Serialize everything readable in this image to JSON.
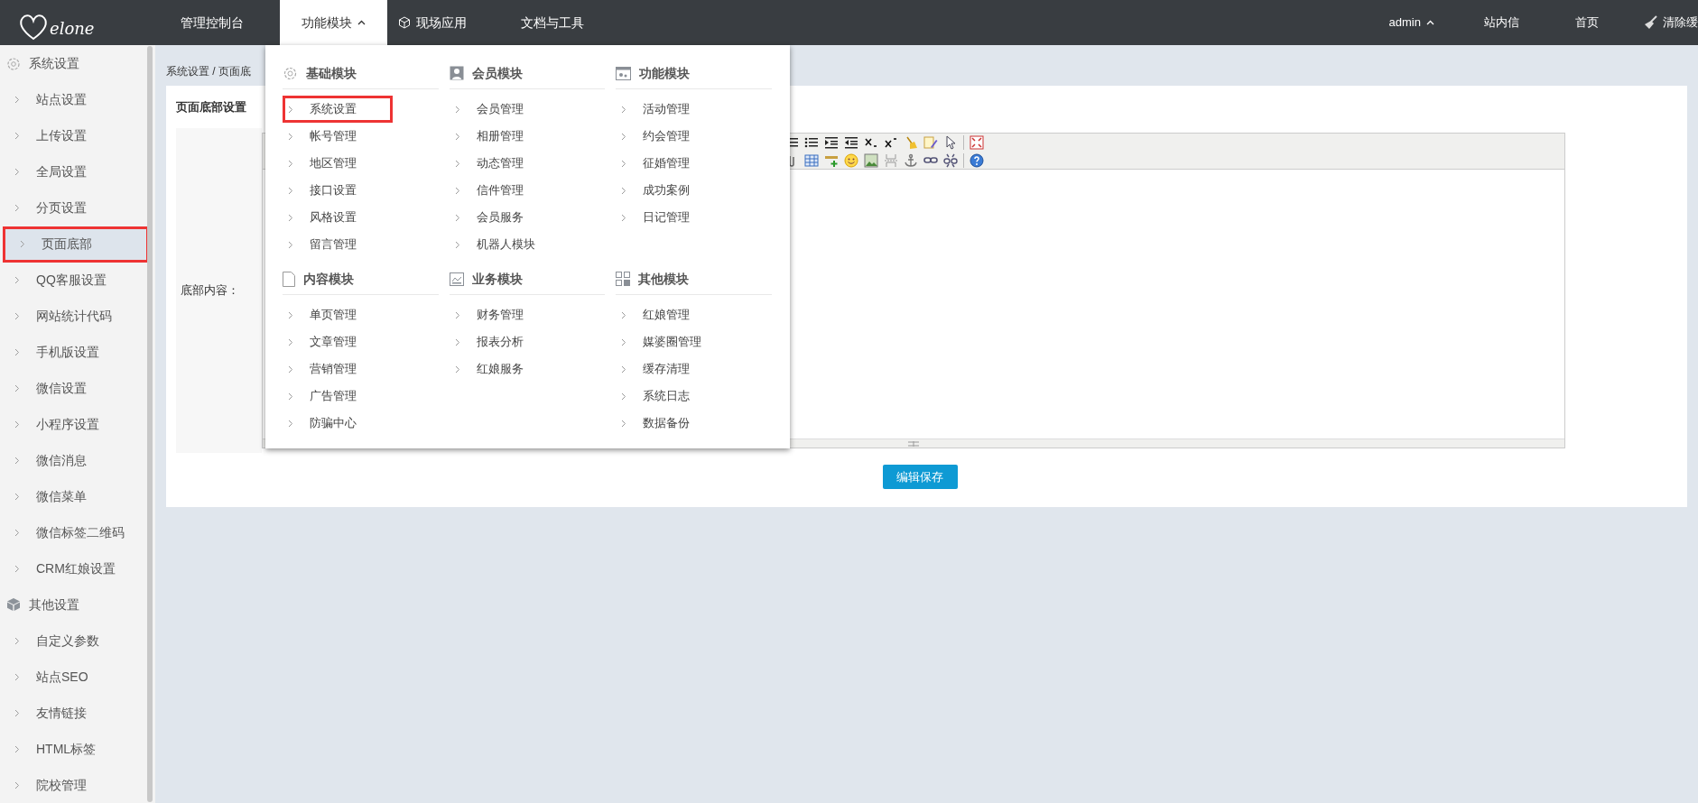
{
  "header": {
    "logo": "elone",
    "nav": [
      {
        "label": "管理控制台",
        "selected": false
      },
      {
        "label": "功能模块",
        "selected": true,
        "expanded": true
      },
      {
        "label": "现场应用",
        "selected": false
      },
      {
        "label": "文档与工具",
        "selected": false
      }
    ],
    "user": {
      "label": "admin",
      "expanded": true
    },
    "right_links": [
      "站内信",
      "首页",
      "清除缓"
    ]
  },
  "sidebar": [
    {
      "title": "系统设置",
      "children": [
        {
          "label": "站点设置",
          "selected": false
        },
        {
          "label": "上传设置",
          "selected": false
        },
        {
          "label": "全局设置",
          "selected": false
        },
        {
          "label": "分页设置",
          "selected": false
        },
        {
          "label": "页面底部",
          "selected": true
        },
        {
          "label": "QQ客服设置",
          "selected": false
        },
        {
          "label": "网站统计代码",
          "selected": false
        },
        {
          "label": "手机版设置",
          "selected": false
        },
        {
          "label": "微信设置",
          "selected": false
        },
        {
          "label": "小程序设置",
          "selected": false
        },
        {
          "label": "微信消息",
          "selected": false
        },
        {
          "label": "微信菜单",
          "selected": false
        },
        {
          "label": "微信标签二维码",
          "selected": false
        },
        {
          "label": "CRM红娘设置",
          "selected": false
        }
      ]
    },
    {
      "title": "其他设置",
      "children": [
        {
          "label": "自定义参数",
          "selected": false
        },
        {
          "label": "站点SEO",
          "selected": false
        },
        {
          "label": "友情链接",
          "selected": false
        },
        {
          "label": "HTML标签",
          "selected": false
        },
        {
          "label": "院校管理",
          "selected": false
        }
      ]
    }
  ],
  "breadcrumb": "系统设置 / 页面底",
  "card": {
    "title": "页面底部设置",
    "field_label": "底部内容：",
    "save_button": "编辑保存"
  },
  "dropdown": [
    {
      "title": "基础模块",
      "items": [
        {
          "label": "系统设置",
          "selected": true
        },
        {
          "label": "帐号管理",
          "selected": false
        },
        {
          "label": "地区管理",
          "selected": false
        },
        {
          "label": "接口设置",
          "selected": false
        },
        {
          "label": "风格设置",
          "selected": false
        },
        {
          "label": "留言管理",
          "selected": false
        }
      ]
    },
    {
      "title": "会员模块",
      "items": [
        {
          "label": "会员管理",
          "selected": false
        },
        {
          "label": "相册管理",
          "selected": false
        },
        {
          "label": "动态管理",
          "selected": false
        },
        {
          "label": "信件管理",
          "selected": false
        },
        {
          "label": "会员服务",
          "selected": false
        },
        {
          "label": "机器人模块",
          "selected": false
        }
      ]
    },
    {
      "title": "功能模块",
      "items": [
        {
          "label": "活动管理",
          "selected": false
        },
        {
          "label": "约会管理",
          "selected": false
        },
        {
          "label": "征婚管理",
          "selected": false
        },
        {
          "label": "成功案例",
          "selected": false
        },
        {
          "label": "日记管理",
          "selected": false
        }
      ]
    },
    {
      "title": "内容模块",
      "items": [
        {
          "label": "单页管理",
          "selected": false
        },
        {
          "label": "文章管理",
          "selected": false
        },
        {
          "label": "营销管理",
          "selected": false
        },
        {
          "label": "广告管理",
          "selected": false
        },
        {
          "label": "防骗中心",
          "selected": false
        }
      ]
    },
    {
      "title": "业务模块",
      "items": [
        {
          "label": "财务管理",
          "selected": false
        },
        {
          "label": "报表分析",
          "selected": false
        },
        {
          "label": "红娘服务",
          "selected": false
        }
      ]
    },
    {
      "title": "其他模块",
      "items": [
        {
          "label": "红娘管理",
          "selected": false
        },
        {
          "label": "媒婆圈管理",
          "selected": false
        },
        {
          "label": "缓存清理",
          "selected": false
        },
        {
          "label": "系统日志",
          "selected": false
        },
        {
          "label": "数据备份",
          "selected": false
        }
      ]
    }
  ]
}
